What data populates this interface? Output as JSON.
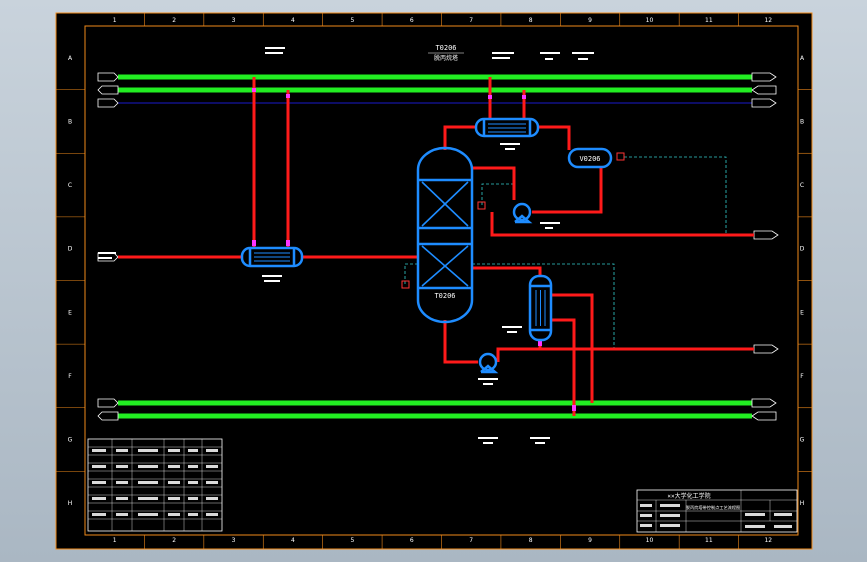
{
  "colors": {
    "frame_border": "#f08a1a",
    "background": "#000000",
    "utility_line": "#22ee22",
    "process_line": "#ff1a1a",
    "equipment": "#1e8cff",
    "signal_line": "#33cccc",
    "junction": "#ff33ff"
  },
  "grid": {
    "columns": [
      "1",
      "2",
      "3",
      "4",
      "5",
      "6",
      "7",
      "8",
      "9",
      "10",
      "11",
      "12"
    ],
    "rows": [
      "A",
      "B",
      "C",
      "D",
      "E",
      "F",
      "G",
      "H"
    ]
  },
  "header": {
    "title_tag": "T0206",
    "title_sub": "脱丙烷塔"
  },
  "equipment": {
    "column_tag": "T0206",
    "drum_tag": "V0206"
  },
  "title_block": {
    "school": "××大学化工学院",
    "drawing_name": "脱丙烷塔带控制点工艺流程图"
  }
}
